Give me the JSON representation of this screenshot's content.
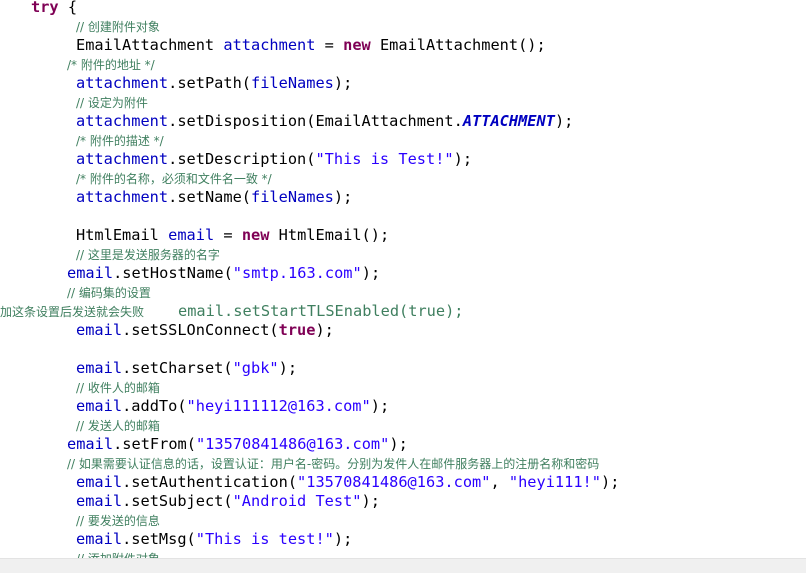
{
  "code": {
    "l01_kw": "try",
    "l01_rest": " {",
    "l02_cmt": "// 创建附件对象",
    "l03_type": "EmailAttachment ",
    "l03_var": "attachment",
    "l03_eq": " = ",
    "l03_new": "new",
    "l03_rest": " EmailAttachment();",
    "l04_cmt": "/* 附件的地址 */",
    "l05_var": "attachment",
    "l05_call": ".setPath(",
    "l05_arg": "fileNames",
    "l05_end": ");",
    "l06_cmt": "// 设定为附件",
    "l07_var": "attachment",
    "l07_call": ".setDisposition(EmailAttachment.",
    "l07_const": "ATTACHMENT",
    "l07_end": ");",
    "l08_cmt": "/* 附件的描述 */",
    "l09_var": "attachment",
    "l09_call": ".setDescription(",
    "l09_str": "\"This is Test!\"",
    "l09_end": ");",
    "l10_cmt": "/* 附件的名称，必须和文件名一致 */",
    "l11_var": "attachment",
    "l11_call": ".setName(",
    "l11_arg": "fileNames",
    "l11_end": ");",
    "l12_type": "HtmlEmail ",
    "l12_var": "email",
    "l12_eq": " = ",
    "l12_new": "new",
    "l12_rest": " HtmlEmail();",
    "l13_cmt": "// 这里是发送服务器的名字",
    "l14_var": "email",
    "l14_call": ".setHostName(",
    "l14_str": "\"smtp.163.com\"",
    "l14_end": ");",
    "l15_cmt": "// 编码集的设置",
    "l16_note": "加这条设置后发送就会失败",
    "l16_code": "email.setStartTLSEnabled(true);",
    "l17_var": "email",
    "l17_call": ".setSSLOnConnect(",
    "l17_kw": "true",
    "l17_end": ");",
    "l18_var": "email",
    "l18_call": ".setCharset(",
    "l18_str": "\"gbk\"",
    "l18_end": ");",
    "l19_cmt": "// 收件人的邮箱",
    "l20_var": "email",
    "l20_call": ".addTo(",
    "l20_str": "\"heyi111112@163.com\"",
    "l20_end": ");",
    "l21_cmt": "// 发送人的邮箱",
    "l22_var": "email",
    "l22_call": ".setFrom(",
    "l22_str": "\"13570841486@163.com\"",
    "l22_end": ");",
    "l23_cmt": "// 如果需要认证信息的话，设置认证：用户名-密码。分别为发件人在邮件服务器上的注册名称和密码",
    "l24_var": "email",
    "l24_call": ".setAuthentication(",
    "l24_str1": "\"13570841486@163.com\"",
    "l24_sep": ", ",
    "l24_str2": "\"heyi111!\"",
    "l24_end": ");",
    "l25_var": "email",
    "l25_call": ".setSubject(",
    "l25_str": "\"Android Test\"",
    "l25_end": ");",
    "l26_cmt": "// 要发送的信息",
    "l27_var": "email",
    "l27_call": ".setMsg(",
    "l27_str": "\"This is test!\"",
    "l27_end": ");",
    "l28_cmt": "// 添加附件对象"
  },
  "colors": {
    "keyword": "#7f0055",
    "field": "#0000c0",
    "string": "#2a00ff",
    "comment": "#3f7f5f"
  }
}
